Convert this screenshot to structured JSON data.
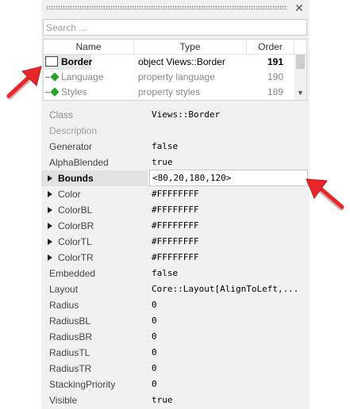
{
  "panel": {
    "close_icon": "close-icon",
    "search": {
      "placeholder": "Search ..."
    },
    "tree": {
      "headers": {
        "name": "Name",
        "type": "Type",
        "order": "Order"
      },
      "rows": [
        {
          "name": "Border",
          "type": "object Views::Border",
          "order": "191"
        },
        {
          "name": "Language",
          "type": "property language",
          "order": "190"
        },
        {
          "name": "Styles",
          "type": "property styles",
          "order": "189"
        }
      ]
    },
    "properties": [
      {
        "name": "Class",
        "value": "Views::Border"
      },
      {
        "name": "Description",
        "value": ""
      },
      {
        "name": "Generator",
        "value": "false"
      },
      {
        "name": "AlphaBlended",
        "value": "true"
      },
      {
        "name": "Bounds",
        "value": "<80,20,180,120>"
      },
      {
        "name": "Color",
        "value": "#FFFFFFFF"
      },
      {
        "name": "ColorBL",
        "value": "#FFFFFFFF"
      },
      {
        "name": "ColorBR",
        "value": "#FFFFFFFF"
      },
      {
        "name": "ColorTL",
        "value": "#FFFFFFFF"
      },
      {
        "name": "ColorTR",
        "value": "#FFFFFFFF"
      },
      {
        "name": "Embedded",
        "value": "false"
      },
      {
        "name": "Layout",
        "value": "Core::Layout[AlignToLeft,..."
      },
      {
        "name": "Radius",
        "value": "0"
      },
      {
        "name": "RadiusBL",
        "value": "0"
      },
      {
        "name": "RadiusBR",
        "value": "0"
      },
      {
        "name": "RadiusTL",
        "value": "0"
      },
      {
        "name": "RadiusTR",
        "value": "0"
      },
      {
        "name": "StackingPriority",
        "value": "0"
      },
      {
        "name": "Visible",
        "value": "true"
      }
    ]
  },
  "colors": {
    "annotation_arrow": "#e8262a",
    "tree_node_diamond": "#2aa12a"
  }
}
